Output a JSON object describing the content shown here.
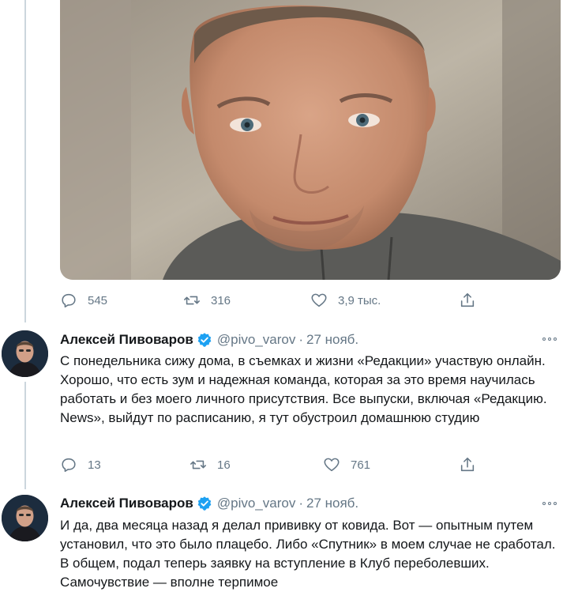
{
  "tweet1": {
    "photo_alt": "selfie-photo",
    "actions": {
      "reply": "545",
      "retweet": "316",
      "like": "3,9 тыс."
    }
  },
  "tweet2": {
    "author": "Алексей Пивоваров",
    "handle": "@pivo_varov",
    "separator": "·",
    "date": "27 нояб.",
    "text": "С понедельника сижу дома, в съемках и жизни «Редакции» участвую онлайн. Хорошо, что есть зум и надежная команда, которая за это время научилась работать и без моего личного присутствия. Все выпуски, включая «Редакцию. News», выйдут по расписанию, я тут обустроил домашнюю студию",
    "actions": {
      "reply": "13",
      "retweet": "16",
      "like": "761"
    }
  },
  "tweet3": {
    "author": "Алексей Пивоваров",
    "handle": "@pivo_varov",
    "separator": "·",
    "date": "27 нояб.",
    "text": "И да, два месяца назад я делал прививку от ковида. Вот — опытным путем установил, что это было плацебо. Либо «Спутник» в моем случае не сработал. В общем, подал теперь заявку на вступление в Клуб переболевших. Самочувствие — вполне терпимое"
  },
  "colors": {
    "text": "#14171a",
    "muted": "#657786",
    "verified": "#1da1f2",
    "thread": "#ccd6dd"
  },
  "icons": [
    "reply-icon",
    "retweet-icon",
    "like-icon",
    "share-icon",
    "verified-badge-icon",
    "more-options-icon"
  ]
}
